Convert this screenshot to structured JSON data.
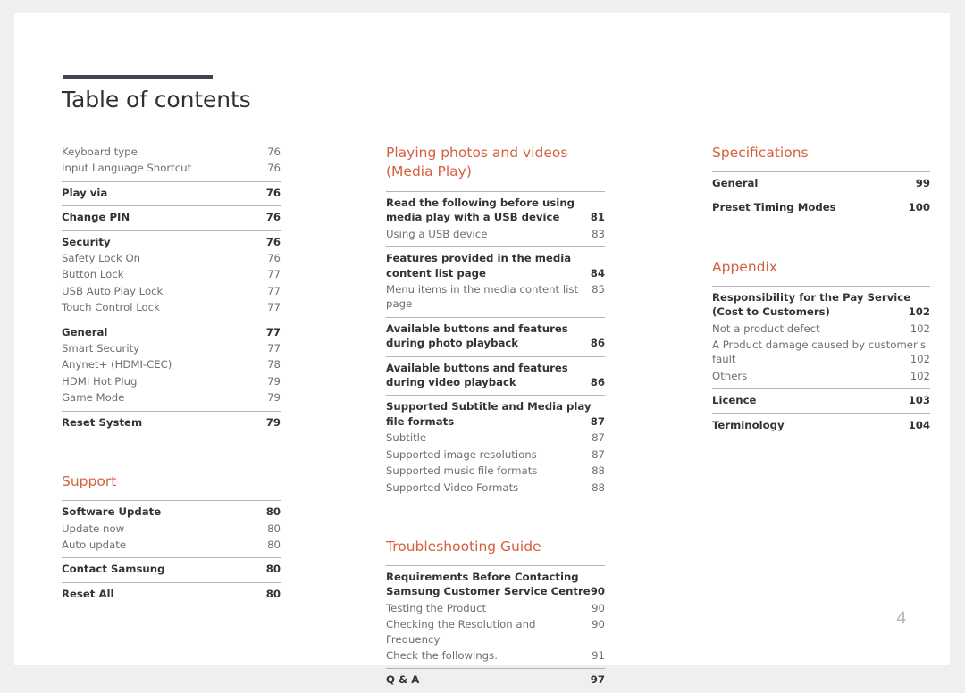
{
  "document": {
    "title": "Table of contents",
    "folio": "4",
    "accent_color": "#d4603e",
    "rule_color": "#474154"
  },
  "columns": [
    {
      "name": "column-1",
      "sections": [
        {
          "heading": null,
          "groups": [
            {
              "rule": false,
              "entries": [
                {
                  "label": "Keyboard type",
                  "page": "76",
                  "level": 2
                },
                {
                  "label": "Input Language Shortcut",
                  "page": "76",
                  "level": 2
                }
              ]
            },
            {
              "rule": true,
              "entries": [
                {
                  "label": "Play via",
                  "page": "76",
                  "level": 1
                }
              ]
            },
            {
              "rule": true,
              "entries": [
                {
                  "label": "Change PIN",
                  "page": "76",
                  "level": 1
                }
              ]
            },
            {
              "rule": true,
              "entries": [
                {
                  "label": "Security",
                  "page": "76",
                  "level": 1
                },
                {
                  "label": "Safety Lock On",
                  "page": "76",
                  "level": 2
                },
                {
                  "label": "Button Lock",
                  "page": "77",
                  "level": 2
                },
                {
                  "label": "USB Auto Play Lock",
                  "page": "77",
                  "level": 2
                },
                {
                  "label": "Touch Control Lock",
                  "page": "77",
                  "level": 2
                }
              ]
            },
            {
              "rule": true,
              "entries": [
                {
                  "label": "General",
                  "page": "77",
                  "level": 1
                },
                {
                  "label": "Smart Security",
                  "page": "77",
                  "level": 2
                },
                {
                  "label": "Anynet+ (HDMI-CEC)",
                  "page": "78",
                  "level": 2
                },
                {
                  "label": "HDMI Hot Plug",
                  "page": "79",
                  "level": 2
                },
                {
                  "label": "Game Mode",
                  "page": "79",
                  "level": 2
                }
              ]
            },
            {
              "rule": true,
              "entries": [
                {
                  "label": "Reset System",
                  "page": "79",
                  "level": 1
                }
              ]
            }
          ]
        },
        {
          "heading": "Support",
          "groups": [
            {
              "rule": true,
              "entries": [
                {
                  "label": "Software Update",
                  "page": "80",
                  "level": 1
                },
                {
                  "label": "Update now",
                  "page": "80",
                  "level": 2
                },
                {
                  "label": "Auto update",
                  "page": "80",
                  "level": 2
                }
              ]
            },
            {
              "rule": true,
              "entries": [
                {
                  "label": "Contact Samsung",
                  "page": "80",
                  "level": 1
                }
              ]
            },
            {
              "rule": true,
              "entries": [
                {
                  "label": "Reset All",
                  "page": "80",
                  "level": 1
                }
              ]
            }
          ]
        }
      ]
    },
    {
      "name": "column-2",
      "sections": [
        {
          "heading": "Playing photos and videos (Media Play)",
          "groups": [
            {
              "rule": true,
              "entries": [
                {
                  "label": "Read the following before using media play with a USB device",
                  "page": "81",
                  "level": 1,
                  "wrap": true
                },
                {
                  "label": "Using a USB device",
                  "page": "83",
                  "level": 2
                }
              ]
            },
            {
              "rule": true,
              "entries": [
                {
                  "label": "Features provided in the media content list page",
                  "page": "84",
                  "level": 1,
                  "wrap": true
                },
                {
                  "label": "Menu items in the media content list page",
                  "page": "85",
                  "level": 2
                }
              ]
            },
            {
              "rule": true,
              "entries": [
                {
                  "label": "Available buttons and features during photo playback",
                  "page": "86",
                  "level": 1,
                  "wrap": true
                }
              ]
            },
            {
              "rule": true,
              "entries": [
                {
                  "label": "Available buttons and features during video playback",
                  "page": "86",
                  "level": 1,
                  "wrap": true
                }
              ]
            },
            {
              "rule": true,
              "entries": [
                {
                  "label": "Supported Subtitle and Media play file formats",
                  "page": "87",
                  "level": 1,
                  "wrap": true
                },
                {
                  "label": "Subtitle",
                  "page": "87",
                  "level": 2
                },
                {
                  "label": "Supported image resolutions",
                  "page": "87",
                  "level": 2
                },
                {
                  "label": "Supported music file formats",
                  "page": "88",
                  "level": 2
                },
                {
                  "label": "Supported Video Formats",
                  "page": "88",
                  "level": 2
                }
              ]
            }
          ]
        },
        {
          "heading": "Troubleshooting Guide",
          "groups": [
            {
              "rule": true,
              "entries": [
                {
                  "label": "Requirements Before Contacting Samsung Customer Service Centre",
                  "page": "90",
                  "level": 1,
                  "wrap": true
                },
                {
                  "label": "Testing the Product",
                  "page": "90",
                  "level": 2
                },
                {
                  "label": "Checking the Resolution and Frequency",
                  "page": "90",
                  "level": 2
                },
                {
                  "label": "Check the followings.",
                  "page": "91",
                  "level": 2
                }
              ]
            },
            {
              "rule": true,
              "entries": [
                {
                  "label": "Q & A",
                  "page": "97",
                  "level": 1
                }
              ]
            }
          ]
        }
      ]
    },
    {
      "name": "column-3",
      "sections": [
        {
          "heading": "Specifications",
          "groups": [
            {
              "rule": true,
              "entries": [
                {
                  "label": "General",
                  "page": "99",
                  "level": 1
                }
              ]
            },
            {
              "rule": true,
              "entries": [
                {
                  "label": "Preset Timing Modes",
                  "page": "100",
                  "level": 1
                }
              ]
            }
          ]
        },
        {
          "heading": "Appendix",
          "groups": [
            {
              "rule": true,
              "entries": [
                {
                  "label": "Responsibility for the Pay Service (Cost to Customers)",
                  "page": "102",
                  "level": 1,
                  "wrap": true
                },
                {
                  "label": "Not a product defect",
                  "page": "102",
                  "level": 2
                },
                {
                  "label": "A Product damage caused by customer's fault",
                  "page": "102",
                  "level": 2,
                  "wrap": true
                },
                {
                  "label": "Others",
                  "page": "102",
                  "level": 2
                }
              ]
            },
            {
              "rule": true,
              "entries": [
                {
                  "label": "Licence",
                  "page": "103",
                  "level": 1
                }
              ]
            },
            {
              "rule": true,
              "entries": [
                {
                  "label": "Terminology",
                  "page": "104",
                  "level": 1
                }
              ]
            }
          ]
        }
      ]
    }
  ]
}
